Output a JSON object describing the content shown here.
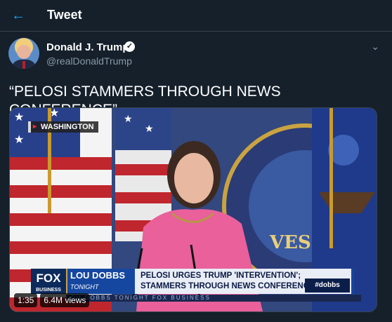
{
  "header": {
    "back_icon": "arrow-left-icon",
    "title": "Tweet"
  },
  "author": {
    "name": "Donald J. Trump",
    "handle": "@realDonaldTrump",
    "verified_icon": "verified-badge-icon",
    "more_icon": "chevron-down-icon"
  },
  "tweet": {
    "text": "“PELOSI STAMMERS THROUGH NEWS CONFERENCE”"
  },
  "video": {
    "location_tag": "WASHINGTON",
    "network_logo": "FOX",
    "network_sub": "BUSINESS",
    "show_name": "LOU DOBBS",
    "show_sub": "TONIGHT",
    "headline_line1": "PELOSI URGES TRUMP 'INTERVENTION';",
    "headline_line2": "STAMMERS THROUGH NEWS CONFERENCE",
    "hashtag": "#dobbs",
    "ticker": "LOU DOBBS TONIGHT     FOX BUSINESS",
    "duration": "1:35",
    "views": "6.4M views"
  },
  "colors": {
    "background": "#15202b",
    "accent": "#1da1f2",
    "muted": "#8899a6",
    "border": "#38444d"
  }
}
